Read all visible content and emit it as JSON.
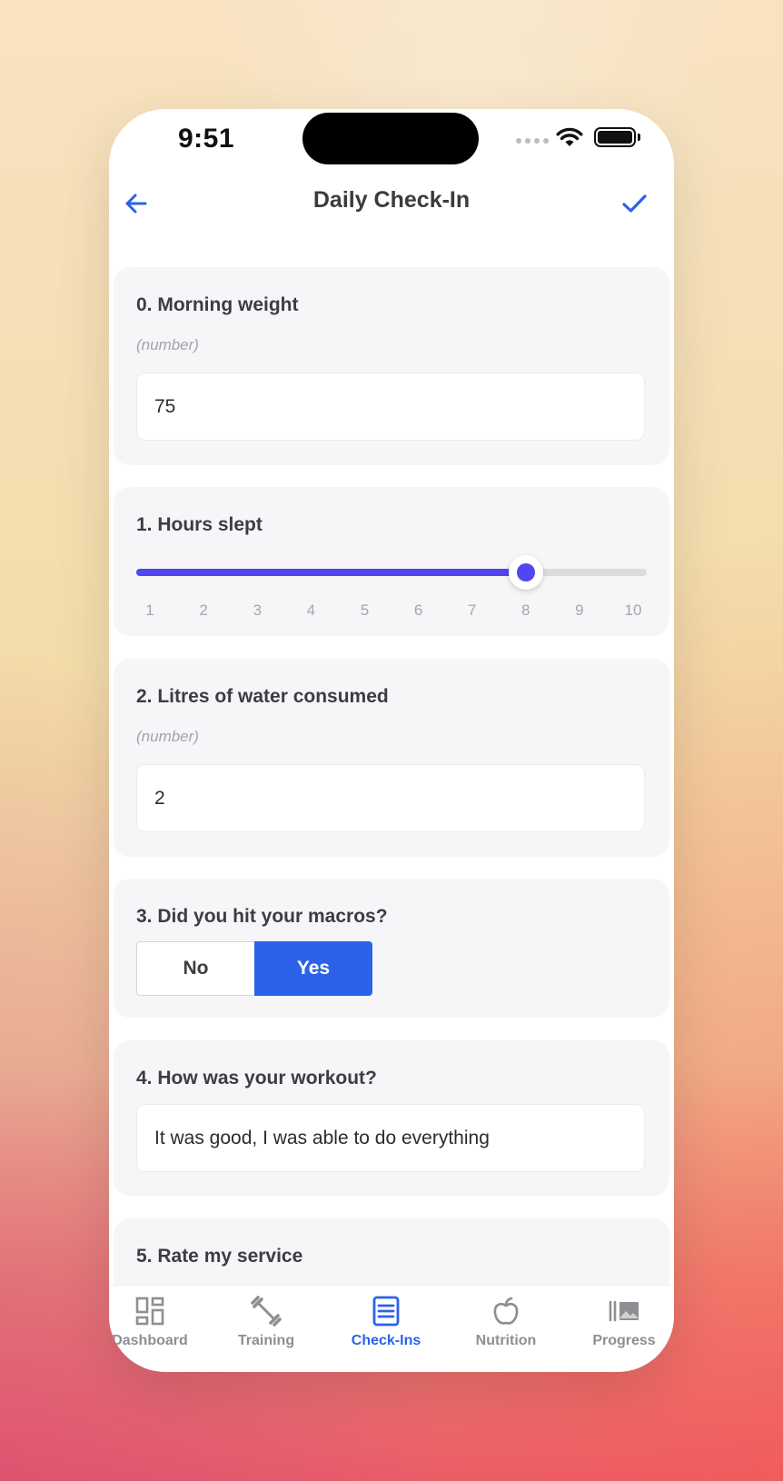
{
  "status_bar": {
    "time": "9:51"
  },
  "header": {
    "title": "Daily Check-In"
  },
  "questions": [
    {
      "label": "0. Morning weight",
      "hint": "(number)",
      "value": "75"
    },
    {
      "label": "1. Hours slept",
      "min": 1,
      "max": 10,
      "value": 8,
      "ticks": [
        "1",
        "2",
        "3",
        "4",
        "5",
        "6",
        "7",
        "8",
        "9",
        "10"
      ]
    },
    {
      "label": "2. Litres of water consumed",
      "hint": "(number)",
      "value": "2"
    },
    {
      "label": "3. Did you hit your macros?",
      "options": [
        "No",
        "Yes"
      ],
      "selected": "Yes"
    },
    {
      "label": "4. How was your workout?",
      "value": "It was good, I was able to do everything"
    },
    {
      "label": "5. Rate my service"
    }
  ],
  "tab_bar": {
    "items": [
      {
        "label": "Dashboard",
        "icon": "dashboard-icon"
      },
      {
        "label": "Training",
        "icon": "dumbbell-icon"
      },
      {
        "label": "Check-Ins",
        "icon": "checkin-icon",
        "active": true
      },
      {
        "label": "Nutrition",
        "icon": "apple-icon"
      },
      {
        "label": "Progress",
        "icon": "photos-icon"
      }
    ]
  },
  "colors": {
    "accent": "#2b63e8",
    "slider": "#5146ef",
    "card_bg": "#f6f6f8"
  }
}
